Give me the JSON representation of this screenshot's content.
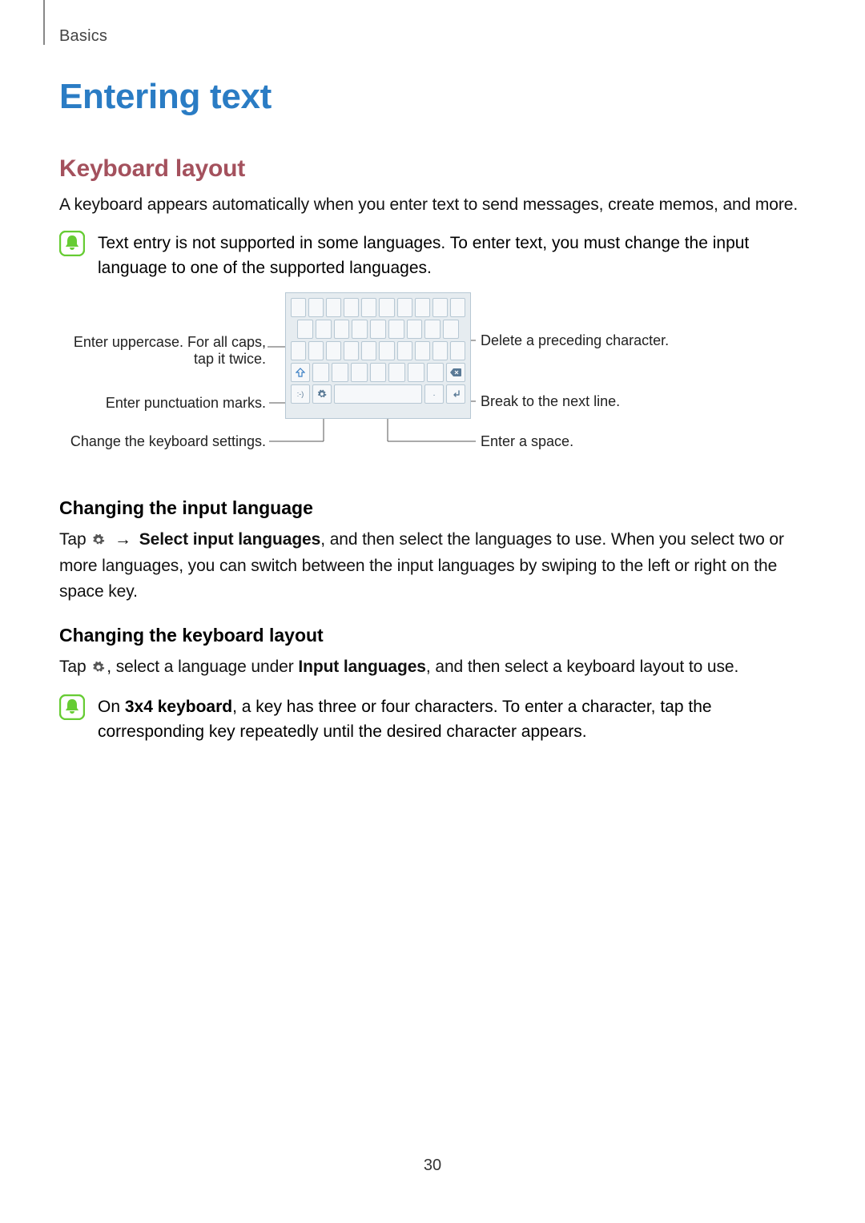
{
  "header": {
    "section": "Basics"
  },
  "title": "Entering text",
  "sections": {
    "keyboard_layout": {
      "heading": "Keyboard layout",
      "intro": "A keyboard appears automatically when you enter text to send messages, create memos, and more.",
      "note": "Text entry is not supported in some languages. To enter text, you must change the input language to one of the supported languages."
    },
    "diagram": {
      "callouts": {
        "uppercase": "Enter uppercase. For all caps, tap it twice.",
        "punctuation": "Enter punctuation marks.",
        "settings": "Change the keyboard settings.",
        "delete": "Delete a preceding character.",
        "newline": "Break to the next line.",
        "space": "Enter a space."
      }
    },
    "change_lang": {
      "heading": "Changing the input language",
      "pre": "Tap ",
      "arrow": " → ",
      "bold": "Select input languages",
      "post": ", and then select the languages to use. When you select two or more languages, you can switch between the input languages by swiping to the left or right on the space key."
    },
    "change_layout": {
      "heading": "Changing the keyboard layout",
      "pre": "Tap ",
      "mid1": ", select a language under ",
      "bold": "Input languages",
      "post": ", and then select a keyboard layout to use.",
      "note_pre": "On ",
      "note_bold": "3x4 keyboard",
      "note_post": ", a key has three or four characters. To enter a character, tap the corresponding key repeatedly until the desired character appears."
    }
  },
  "page_number": "30",
  "icons": {
    "bell": "bell-icon",
    "gear": "gear-icon",
    "arrow_right": "→"
  }
}
